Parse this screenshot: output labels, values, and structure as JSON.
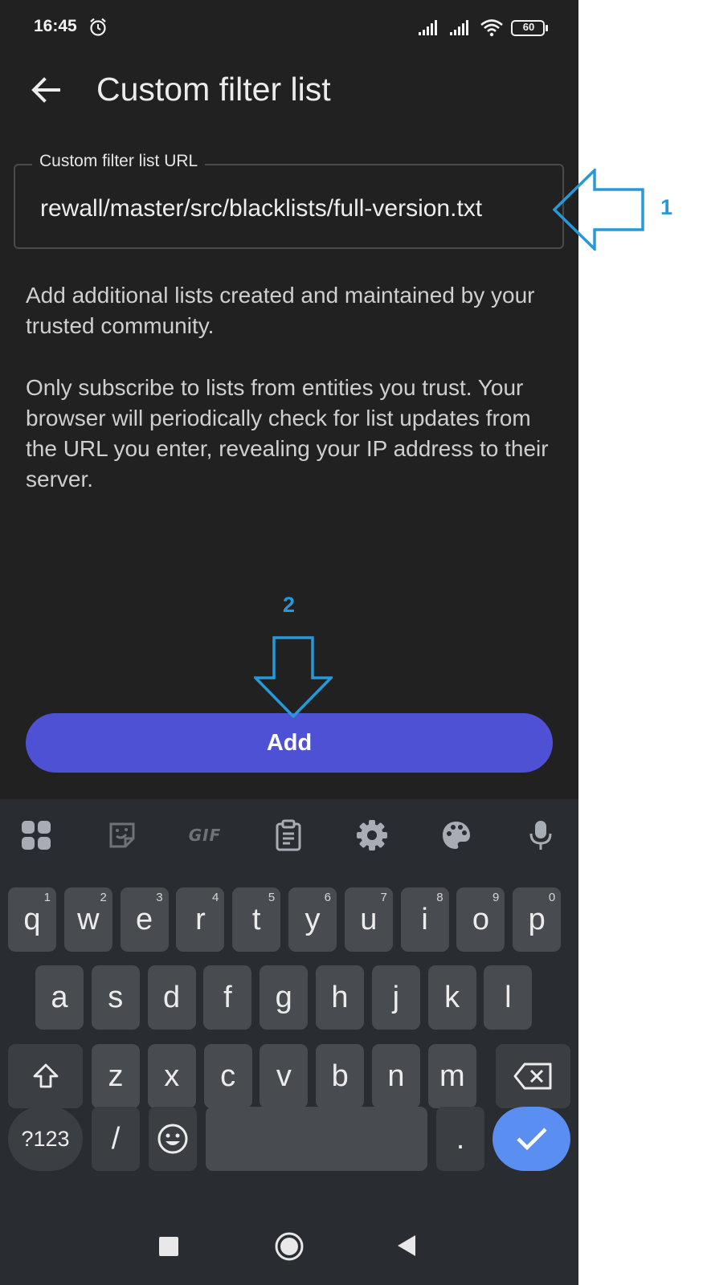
{
  "status_bar": {
    "time": "16:45",
    "battery": "60",
    "icons": [
      "alarm-icon",
      "signal-icon",
      "signal-icon",
      "wifi-icon",
      "battery-icon"
    ]
  },
  "app_bar": {
    "back_icon": "arrow-back-icon",
    "title": "Custom filter list"
  },
  "url_field": {
    "label": "Custom filter list URL",
    "value": "rewall/master/src/blacklists/full-version.txt"
  },
  "description": {
    "paragraph_1": "Add additional lists created and maintained by your trusted community.",
    "paragraph_2": "Only subscribe to lists from entities you trust. Your browser will periodically check for list updates from the URL you enter, revealing your IP address to their server."
  },
  "add_button": {
    "label": "Add",
    "color": "#4e51d4"
  },
  "keyboard": {
    "toolbar": {
      "icons": [
        "apps-grid-icon",
        "sticker-icon",
        "gif-icon",
        "clipboard-icon",
        "gear-icon",
        "palette-icon",
        "microphone-icon"
      ],
      "gif_label": "GIF"
    },
    "row1": [
      {
        "key": "q",
        "hint": "1"
      },
      {
        "key": "w",
        "hint": "2"
      },
      {
        "key": "e",
        "hint": "3"
      },
      {
        "key": "r",
        "hint": "4"
      },
      {
        "key": "t",
        "hint": "5"
      },
      {
        "key": "y",
        "hint": "6"
      },
      {
        "key": "u",
        "hint": "7"
      },
      {
        "key": "i",
        "hint": "8"
      },
      {
        "key": "o",
        "hint": "9"
      },
      {
        "key": "p",
        "hint": "0"
      }
    ],
    "row2": [
      "a",
      "s",
      "d",
      "f",
      "g",
      "h",
      "j",
      "k",
      "l"
    ],
    "row3": [
      "z",
      "x",
      "c",
      "v",
      "b",
      "n",
      "m"
    ],
    "bottom": {
      "symbols": "?123",
      "slash": "/",
      "period": "."
    },
    "enter_color": "#5a8ef0"
  },
  "annotations": {
    "arrow_1_label": "1",
    "arrow_2_label": "2",
    "color": "#2699d9"
  }
}
